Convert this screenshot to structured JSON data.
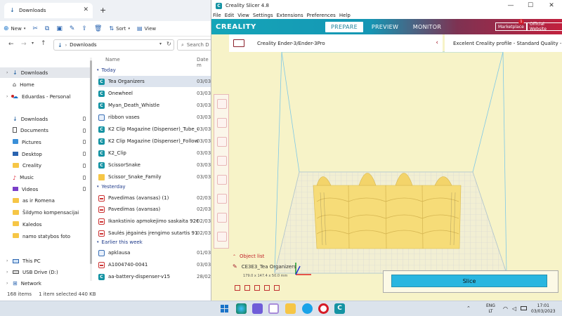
{
  "explorer": {
    "tab_title": "Downloads",
    "toolbar": {
      "new": "New",
      "sort": "Sort",
      "view": "View"
    },
    "address": "Downloads",
    "search_placeholder": "Search D",
    "nav": {
      "downloads": "Downloads",
      "home": "Home",
      "personal": "Eduardas - Personal",
      "quick": [
        {
          "label": "Downloads"
        },
        {
          "label": "Documents"
        },
        {
          "label": "Pictures"
        },
        {
          "label": "Desktop"
        },
        {
          "label": "Creality"
        },
        {
          "label": "Music"
        },
        {
          "label": "Videos"
        },
        {
          "label": "as ir Romena"
        },
        {
          "label": "Šildymo kompensacijai"
        },
        {
          "label": "Kaledos"
        },
        {
          "label": "namo statybos foto"
        }
      ],
      "this_pc": "This PC",
      "usb": "USB Drive (D:)",
      "network": "Network"
    },
    "columns": {
      "name": "Name",
      "date": "Date m"
    },
    "groups": {
      "today": "Today",
      "yesterday": "Yesterday",
      "earlier": "Earlier this week"
    },
    "files": [
      {
        "name": "Tea Organizers",
        "date": "03/03/",
        "type": "c"
      },
      {
        "name": "Onewheel",
        "date": "03/03/",
        "type": "c"
      },
      {
        "name": "Myan_Death_Whistle",
        "date": "03/03/",
        "type": "c"
      },
      {
        "name": "ribbon vases",
        "date": "03/03/",
        "type": "img"
      },
      {
        "name": "K2 Clip Magazine (Dispenser)_Tube_v0_1",
        "date": "03/03/",
        "type": "c"
      },
      {
        "name": "K2 Clip Magazine (Dispenser)_Follower_v0",
        "date": "03/03/",
        "type": "c"
      },
      {
        "name": "K2_Clip",
        "date": "03/03/",
        "type": "c"
      },
      {
        "name": "ScissorSnake",
        "date": "03/03/",
        "type": "c"
      },
      {
        "name": "Scissor_Snake_Family",
        "date": "03/03/",
        "type": "fold"
      },
      {
        "name": "Pavedimas (avansas) (1)",
        "date": "02/03/",
        "type": "pdf"
      },
      {
        "name": "Pavedimas (avansas)",
        "date": "02/03/",
        "type": "pdf"
      },
      {
        "name": "Ikankstinio apmokejimo saskaita 9265",
        "date": "02/03/",
        "type": "pdf"
      },
      {
        "name": "Saulės jėgainės įrengimo sutartis 9109",
        "date": "02/03/",
        "type": "pdf"
      },
      {
        "name": "apklausa",
        "date": "01/03/",
        "type": "img"
      },
      {
        "name": "A1004740-0041",
        "date": "03/03/",
        "type": "pdf"
      },
      {
        "name": "aa-battery-dispenser-v15",
        "date": "28/02/",
        "type": "c"
      }
    ],
    "status": {
      "count": "168 items",
      "selected": "1 item selected  440 KB"
    }
  },
  "creality": {
    "title": "Creality Slicer 4.8",
    "menu": [
      "File",
      "Edit",
      "View",
      "Settings",
      "Extensions",
      "Preferences",
      "Help"
    ],
    "brand": "CREALITY",
    "tabs": [
      "PREPARE",
      "PREVIEW",
      "MONITOR"
    ],
    "marketplace": "Marketplace",
    "marketplace_badge": "1",
    "official": "Official Website",
    "printer": "Creality Ender-3/Ender-3Pro",
    "profile": "Excelent Creality profile - Standard Quality - 0",
    "object_list": "Object list",
    "object_name": "CE3E3_Tea Organizers",
    "object_size": "179.0 x 147.4 x 50.0 mm",
    "slice": "Slice"
  },
  "taskbar": {
    "lang1": "ENG",
    "lang2": "LT",
    "time": "17:01",
    "date": "03/03/2023"
  },
  "colors": {
    "accent": "#15a5b8",
    "model": "#f6d870",
    "slice": "#29b6e0"
  }
}
